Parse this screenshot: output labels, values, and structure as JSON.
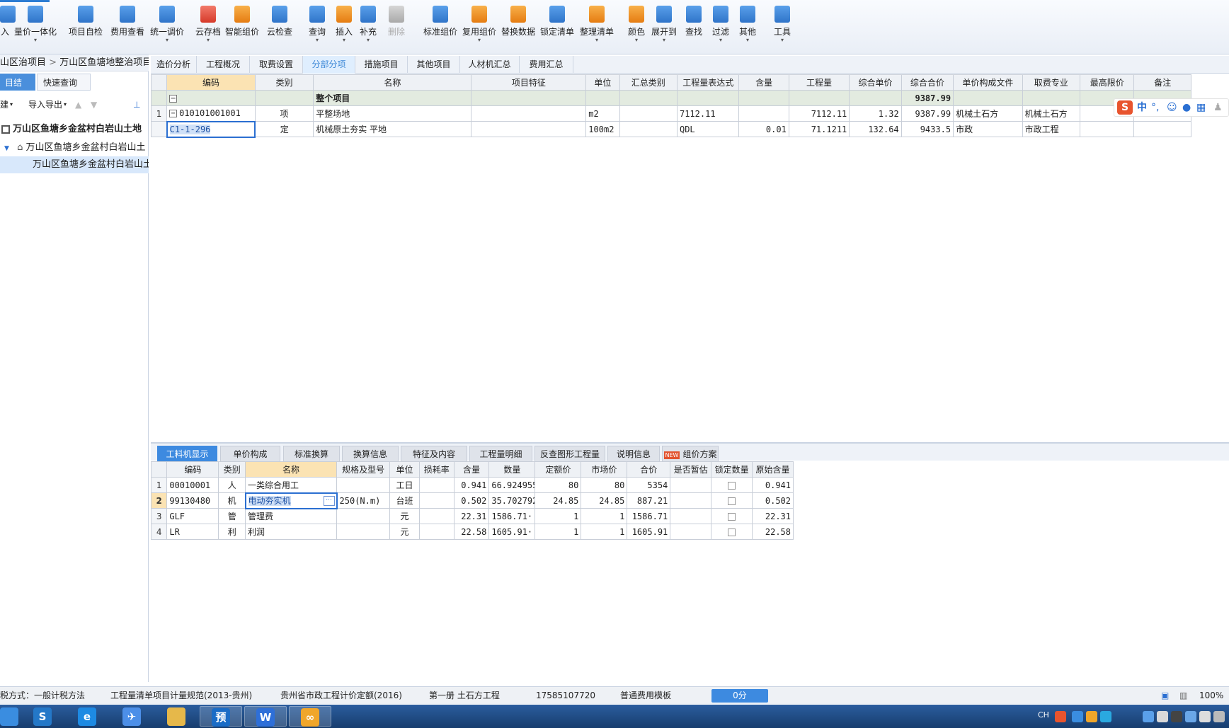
{
  "toolbar": {
    "buttons": [
      {
        "label": "入",
        "icon": "import-icon"
      },
      {
        "label": "量价一体化",
        "icon": "quantity-price-icon",
        "dropdown": true
      },
      {
        "label": "项目自检",
        "icon": "project-check-icon"
      },
      {
        "label": "费用查看",
        "icon": "cost-view-icon"
      },
      {
        "label": "统一调价",
        "icon": "unified-price-icon",
        "dropdown": true
      },
      {
        "label": "云存档",
        "icon": "cloud-save-icon",
        "dropdown": true
      },
      {
        "label": "智能组价",
        "icon": "smart-pricing-icon"
      },
      {
        "label": "云检查",
        "icon": "cloud-check-icon"
      },
      {
        "label": "查询",
        "icon": "query-icon",
        "dropdown": true
      },
      {
        "label": "插入",
        "icon": "insert-icon",
        "dropdown": true
      },
      {
        "label": "补充",
        "icon": "supplement-icon",
        "dropdown": true
      },
      {
        "label": "删除",
        "icon": "delete-icon"
      },
      {
        "label": "标准组价",
        "icon": "standard-pricing-icon"
      },
      {
        "label": "复用组价",
        "icon": "reuse-pricing-icon",
        "dropdown": true
      },
      {
        "label": "替换数据",
        "icon": "replace-data-icon"
      },
      {
        "label": "锁定清单",
        "icon": "lock-list-icon"
      },
      {
        "label": "整理清单",
        "icon": "organize-list-icon",
        "dropdown": true
      },
      {
        "label": "颜色",
        "icon": "color-icon",
        "dropdown": true
      },
      {
        "label": "展开到",
        "icon": "expand-to-icon",
        "dropdown": true
      },
      {
        "label": "查找",
        "icon": "find-icon"
      },
      {
        "label": "过滤",
        "icon": "filter-icon",
        "dropdown": true
      },
      {
        "label": "其他",
        "icon": "other-icon",
        "dropdown": true
      },
      {
        "label": "工具",
        "icon": "tools-icon",
        "dropdown": true
      }
    ]
  },
  "left": {
    "breadcrumb": [
      "山区治项目",
      "万山区鱼塘地整治项目"
    ],
    "tabs": [
      "目结构",
      "快速查询"
    ],
    "actions": [
      "建",
      "导入导出"
    ],
    "tree": [
      {
        "label": "万山区鱼塘乡金盆村白岩山土地",
        "bold": true
      },
      {
        "label": "万山区鱼塘乡金盆村白岩山土"
      },
      {
        "label": "万山区鱼塘乡金盆村白岩山土",
        "selected": true
      }
    ]
  },
  "maintabs": [
    "造价分析",
    "工程概况",
    "取费设置",
    "分部分项",
    "措施项目",
    "其他项目",
    "人材机汇总",
    "费用汇总"
  ],
  "maintabs_active": 3,
  "upper_grid": {
    "headers": [
      "编码",
      "类别",
      "名称",
      "项目特征",
      "单位",
      "汇总类别",
      "工程量表达式",
      "含量",
      "工程量",
      "综合单价",
      "综合合价",
      "单价构成文件",
      "取费专业",
      "最高限价",
      "备注"
    ],
    "whole_row": {
      "label": "整个项目",
      "total": "9387.99"
    },
    "rows": [
      {
        "idx": "1",
        "code": "010101001001",
        "type": "项",
        "name": "平整场地",
        "feature": "",
        "unit": "m2",
        "sum_cat": "",
        "expr": "7112.11",
        "content": "",
        "qty": "7112.11",
        "unit_price": "1.32",
        "total": "9387.99",
        "file": "机械土石方",
        "spec": "机械土石方",
        "max": "",
        "note": ""
      },
      {
        "idx": "",
        "code": "C1-1-296",
        "type": "定",
        "name": "机械原土夯实 平地",
        "feature": "",
        "unit": "100m2",
        "sum_cat": "",
        "expr": "QDL",
        "content": "0.01",
        "qty": "71.1211",
        "unit_price": "132.64",
        "total": "9433.5",
        "file": "市政",
        "spec": "市政工程",
        "max": "",
        "note": ""
      }
    ]
  },
  "bottom_tabs": [
    "工料机显示",
    "单价构成",
    "标准换算",
    "换算信息",
    "特征及内容",
    "工程量明细",
    "反查图形工程量",
    "说明信息",
    "组价方案"
  ],
  "bottom_tabs_new_badge": "NEW",
  "lower_grid": {
    "headers": [
      "编码",
      "类别",
      "名称",
      "规格及型号",
      "单位",
      "损耗率",
      "含量",
      "数量",
      "定额价",
      "市场价",
      "合价",
      "是否暂估",
      "锁定数量",
      "原始含量"
    ],
    "rows": [
      {
        "idx": "1",
        "code": "00010001",
        "type": "人",
        "name": "一类综合用工",
        "spec": "",
        "unit": "工日",
        "loss": "",
        "content": "0.941",
        "qty": "66.924955",
        "quota": "80",
        "market": "80",
        "total": "5354",
        "est": "",
        "orig": "0.941"
      },
      {
        "idx": "2",
        "code": "99130480",
        "type": "机",
        "name": "电动夯实机",
        "spec": "250(N.m)",
        "unit": "台班",
        "loss": "",
        "content": "0.502",
        "qty": "35.702792",
        "quota": "24.85",
        "market": "24.85",
        "total": "887.21",
        "est": "",
        "orig": "0.502"
      },
      {
        "idx": "3",
        "code": "GLF",
        "type": "管",
        "name": "管理费",
        "spec": "",
        "unit": "元",
        "loss": "",
        "content": "22.31",
        "qty": "1586.71···",
        "quota": "1",
        "market": "1",
        "total": "1586.71",
        "est": "",
        "orig": "22.31"
      },
      {
        "idx": "4",
        "code": "LR",
        "type": "利",
        "name": "利润",
        "spec": "",
        "unit": "元",
        "loss": "",
        "content": "22.58",
        "qty": "1605.91···",
        "quota": "1",
        "market": "1",
        "total": "1605.91",
        "est": "",
        "orig": "22.58"
      }
    ]
  },
  "ime": {
    "label": "中"
  },
  "statusbar": {
    "items": [
      "税方式：一般计税方法",
      "工程量清单项目计量规范(2013-贵州)",
      "贵州省市政工程计价定额(2016)",
      "第一册 土石方工程",
      "17585107720",
      "普通费用模板"
    ],
    "score": "0分",
    "zoom": "100%"
  },
  "taskbar": {
    "apps": [
      "sogou-icon",
      "ie-icon",
      "feiq-icon",
      "folder-icon",
      "yu-icon",
      "wps-icon",
      "glodon-icon"
    ],
    "ime_indicator": "CH"
  },
  "colors": {
    "accent": "#3d8ae0",
    "header_highlight": "#fbe3b3",
    "whole_row_bg": "#e3ebe0"
  }
}
